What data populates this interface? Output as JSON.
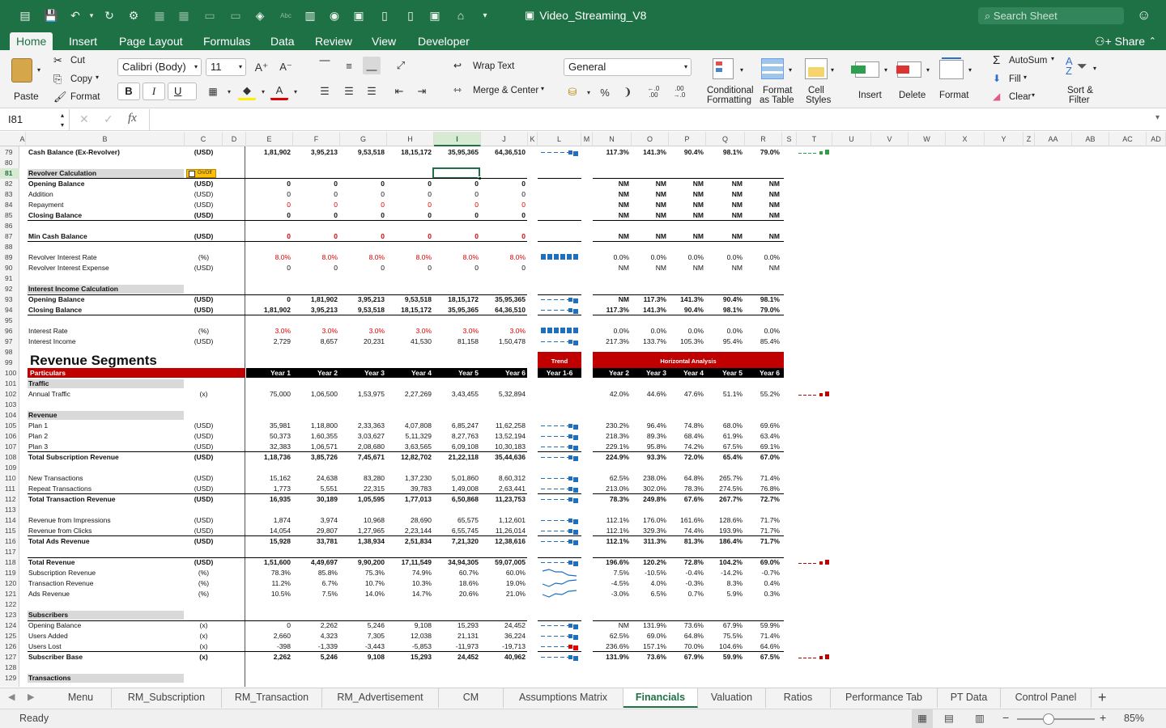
{
  "window": {
    "title": "Video_Streaming_V8",
    "search_placeholder": "Search Sheet"
  },
  "ribbon_tabs": [
    "Home",
    "Insert",
    "Page Layout",
    "Formulas",
    "Data",
    "Review",
    "View",
    "Developer"
  ],
  "share_label": "Share",
  "ribbon": {
    "paste": "Paste",
    "cut": "Cut",
    "copy": "Copy",
    "format": "Format",
    "font_name": "Calibri (Body)",
    "font_size": "11",
    "wrap_text": "Wrap Text",
    "merge_center": "Merge & Center",
    "number_format": "General",
    "conditional_formatting": [
      "Conditional",
      "Formatting"
    ],
    "format_as_table": [
      "Format",
      "as Table"
    ],
    "cell_styles": [
      "Cell",
      "Styles"
    ],
    "insert": "Insert",
    "delete": "Delete",
    "format_cells": "Format",
    "autosum": "AutoSum",
    "fill": "Fill",
    "clear": "Clear",
    "sort_filter": [
      "Sort &",
      "Filter"
    ],
    "bold": "B",
    "italic": "I",
    "underline": "U"
  },
  "formula_bar": {
    "name_box": "I81",
    "fx": "fx",
    "value": ""
  },
  "columns": [
    "A",
    "B",
    "C",
    "D",
    "E",
    "F",
    "G",
    "H",
    "I",
    "J",
    "K",
    "L",
    "M",
    "N",
    "O",
    "P",
    "Q",
    "R",
    "S",
    "T",
    "U",
    "V",
    "W",
    "X",
    "Y",
    "Z",
    "AA",
    "AB",
    "AC",
    "AD"
  ],
  "rows": [
    {
      "n": "79",
      "label": "Cash Balance (Ex-Revolver)",
      "bold": true,
      "unit": "(USD)",
      "vals": [
        "1,81,902",
        "3,95,213",
        "9,53,518",
        "18,15,172",
        "35,95,365",
        "64,36,510"
      ],
      "ha": [
        "117.3%",
        "141.3%",
        "90.4%",
        "98.1%",
        "79.0%"
      ],
      "spark": "bar-green",
      "tspark": "green"
    },
    {
      "n": "80"
    },
    {
      "n": "81",
      "label": "Revolver Calculation",
      "section": true,
      "toggle": "On/Off"
    },
    {
      "n": "82",
      "label": "Opening Balance",
      "bold": true,
      "unit": "(USD)",
      "vals": [
        "0",
        "0",
        "0",
        "0",
        "0",
        "0"
      ],
      "ha": [
        "NM",
        "NM",
        "NM",
        "NM",
        "NM"
      ],
      "hab": true
    },
    {
      "n": "83",
      "label": "Addition",
      "unit": "(USD)",
      "vals": [
        "0",
        "0",
        "0",
        "0",
        "0",
        "0"
      ],
      "ha": [
        "NM",
        "NM",
        "NM",
        "NM",
        "NM"
      ],
      "hab": true
    },
    {
      "n": "84",
      "label": "Repayment",
      "unit": "(USD)",
      "vals": [
        "0",
        "0",
        "0",
        "0",
        "0",
        "0"
      ],
      "red": true,
      "ha": [
        "NM",
        "NM",
        "NM",
        "NM",
        "NM"
      ],
      "hab": true
    },
    {
      "n": "85",
      "label": "Closing Balance",
      "bold": true,
      "unit": "(USD)",
      "vals": [
        "0",
        "0",
        "0",
        "0",
        "0",
        "0"
      ],
      "ha": [
        "NM",
        "NM",
        "NM",
        "NM",
        "NM"
      ],
      "hab": true,
      "line_below": true
    },
    {
      "n": "86"
    },
    {
      "n": "87",
      "label": "Min Cash Balance",
      "bold": true,
      "unit": "(USD)",
      "vals": [
        "0",
        "0",
        "0",
        "0",
        "0",
        "0"
      ],
      "red": true,
      "ha": [
        "NM",
        "NM",
        "NM",
        "NM",
        "NM"
      ],
      "line_below": true
    },
    {
      "n": "88"
    },
    {
      "n": "89",
      "label": "Revolver Interest Rate",
      "unit": "(%)",
      "vals": [
        "8.0%",
        "8.0%",
        "8.0%",
        "8.0%",
        "8.0%",
        "8.0%"
      ],
      "red": true,
      "ha": [
        "0.0%",
        "0.0%",
        "0.0%",
        "0.0%",
        "0.0%"
      ],
      "spark": "flat"
    },
    {
      "n": "90",
      "label": "Revolver Interest Expense",
      "unit": "(USD)",
      "vals": [
        "0",
        "0",
        "0",
        "0",
        "0",
        "0"
      ],
      "ha": [
        "NM",
        "NM",
        "NM",
        "NM",
        "NM"
      ]
    },
    {
      "n": "91"
    },
    {
      "n": "92",
      "label": "Interest Income Calculation",
      "section": true
    },
    {
      "n": "93",
      "label": "Opening Balance",
      "bold": true,
      "unit": "(USD)",
      "vals": [
        "0",
        "1,81,902",
        "3,95,213",
        "9,53,518",
        "18,15,172",
        "35,95,365"
      ],
      "ha": [
        "NM",
        "117.3%",
        "141.3%",
        "90.4%",
        "98.1%"
      ],
      "spark": "bar",
      "line_above": true
    },
    {
      "n": "94",
      "label": "Closing Balance",
      "bold": true,
      "unit": "(USD)",
      "vals": [
        "1,81,902",
        "3,95,213",
        "9,53,518",
        "18,15,172",
        "35,95,365",
        "64,36,510"
      ],
      "ha": [
        "117.3%",
        "141.3%",
        "90.4%",
        "98.1%",
        "79.0%"
      ],
      "spark": "bar",
      "line_below": true
    },
    {
      "n": "95"
    },
    {
      "n": "96",
      "label": "Interest Rate",
      "unit": "(%)",
      "vals": [
        "3.0%",
        "3.0%",
        "3.0%",
        "3.0%",
        "3.0%",
        "3.0%"
      ],
      "red": true,
      "ha": [
        "0.0%",
        "0.0%",
        "0.0%",
        "0.0%",
        "0.0%"
      ],
      "spark": "flat"
    },
    {
      "n": "97",
      "label": "Interest Income",
      "unit": "(USD)",
      "vals": [
        "2,729",
        "8,657",
        "20,231",
        "41,530",
        "81,158",
        "1,50,478"
      ],
      "ha": [
        "217.3%",
        "133.7%",
        "105.3%",
        "95.4%",
        "85.4%"
      ],
      "spark": "bar"
    },
    {
      "n": "98"
    },
    {
      "n": "99",
      "title": "Revenue Segments",
      "trend": "Trend",
      "horizontal": "Horizontal Analysis"
    },
    {
      "n": "100",
      "header": true,
      "label": "Particulars",
      "years": [
        "Year 1",
        "Year 2",
        "Year 3",
        "Year 4",
        "Year 5",
        "Year 6"
      ],
      "trend_range": "Year 1-6",
      "ha_years": [
        "Year 2",
        "Year 3",
        "Year 4",
        "Year 5",
        "Year 6"
      ]
    },
    {
      "n": "101",
      "label": "Traffic",
      "section": true
    },
    {
      "n": "102",
      "label": "Annual Traffic",
      "unit": "(x)",
      "vals": [
        "75,000",
        "1,06,500",
        "1,53,975",
        "2,27,269",
        "3,43,455",
        "5,32,894"
      ],
      "ha": [
        "42.0%",
        "44.6%",
        "47.6%",
        "51.1%",
        "55.2%"
      ],
      "tspark": "red"
    },
    {
      "n": "103"
    },
    {
      "n": "104",
      "label": "Revenue",
      "section": true
    },
    {
      "n": "105",
      "label": "Plan 1",
      "unit": "(USD)",
      "vals": [
        "35,981",
        "1,18,800",
        "2,33,363",
        "4,07,808",
        "6,85,247",
        "11,62,258"
      ],
      "ha": [
        "230.2%",
        "96.4%",
        "74.8%",
        "68.0%",
        "69.6%"
      ],
      "spark": "bar"
    },
    {
      "n": "106",
      "label": "Plan 2",
      "unit": "(USD)",
      "vals": [
        "50,373",
        "1,60,355",
        "3,03,627",
        "5,11,329",
        "8,27,763",
        "13,52,194"
      ],
      "ha": [
        "218.3%",
        "89.3%",
        "68.4%",
        "61.9%",
        "63.4%"
      ],
      "spark": "bar"
    },
    {
      "n": "107",
      "label": "Plan 3",
      "unit": "(USD)",
      "vals": [
        "32,383",
        "1,06,571",
        "2,08,680",
        "3,63,565",
        "6,09,108",
        "10,30,183"
      ],
      "ha": [
        "229.1%",
        "95.8%",
        "74.2%",
        "67.5%",
        "69.1%"
      ],
      "spark": "bar",
      "line_below": true
    },
    {
      "n": "108",
      "label": "Total Subscription Revenue",
      "bold": true,
      "unit": "(USD)",
      "vals": [
        "1,18,736",
        "3,85,726",
        "7,45,671",
        "12,82,702",
        "21,22,118",
        "35,44,636"
      ],
      "ha": [
        "224.9%",
        "93.3%",
        "72.0%",
        "65.4%",
        "67.0%"
      ],
      "spark": "bar"
    },
    {
      "n": "109"
    },
    {
      "n": "110",
      "label": "New Transactions",
      "unit": "(USD)",
      "vals": [
        "15,162",
        "24,638",
        "83,280",
        "1,37,230",
        "5,01,860",
        "8,60,312"
      ],
      "ha": [
        "62.5%",
        "238.0%",
        "64.8%",
        "265.7%",
        "71.4%"
      ],
      "spark": "bar"
    },
    {
      "n": "111",
      "label": "Repeat Transactions",
      "unit": "(USD)",
      "vals": [
        "1,773",
        "5,551",
        "22,315",
        "39,783",
        "1,49,008",
        "2,63,441"
      ],
      "ha": [
        "213.0%",
        "302.0%",
        "78.3%",
        "274.5%",
        "76.8%"
      ],
      "spark": "bar",
      "line_below": true
    },
    {
      "n": "112",
      "label": "Total Transaction Revenue",
      "bold": true,
      "unit": "(USD)",
      "vals": [
        "16,935",
        "30,189",
        "1,05,595",
        "1,77,013",
        "6,50,868",
        "11,23,753"
      ],
      "ha": [
        "78.3%",
        "249.8%",
        "67.6%",
        "267.7%",
        "72.7%"
      ],
      "spark": "bar"
    },
    {
      "n": "113"
    },
    {
      "n": "114",
      "label": "Revenue from Impressions",
      "unit": "(USD)",
      "vals": [
        "1,874",
        "3,974",
        "10,968",
        "28,690",
        "65,575",
        "1,12,601"
      ],
      "ha": [
        "112.1%",
        "176.0%",
        "161.6%",
        "128.6%",
        "71.7%"
      ],
      "spark": "bar"
    },
    {
      "n": "115",
      "label": "Revenue from Clicks",
      "unit": "(USD)",
      "vals": [
        "14,054",
        "29,807",
        "1,27,965",
        "2,23,144",
        "6,55,745",
        "11,26,014"
      ],
      "ha": [
        "112.1%",
        "329.3%",
        "74.4%",
        "193.9%",
        "71.7%"
      ],
      "spark": "bar",
      "line_below": true
    },
    {
      "n": "116",
      "label": "Total Ads Revenue",
      "bold": true,
      "unit": "(USD)",
      "vals": [
        "15,928",
        "33,781",
        "1,38,934",
        "2,51,834",
        "7,21,320",
        "12,38,616"
      ],
      "ha": [
        "112.1%",
        "311.3%",
        "81.3%",
        "186.4%",
        "71.7%"
      ],
      "spark": "bar"
    },
    {
      "n": "117"
    },
    {
      "n": "118",
      "label": "Total Revenue",
      "bold": true,
      "unit": "(USD)",
      "vals": [
        "1,51,600",
        "4,49,697",
        "9,90,200",
        "17,11,549",
        "34,94,305",
        "59,07,005"
      ],
      "ha": [
        "196.6%",
        "120.2%",
        "72.8%",
        "104.2%",
        "69.0%"
      ],
      "spark": "bar",
      "tspark": "red",
      "line_above": true
    },
    {
      "n": "119",
      "label": "Subscription Revenue",
      "unit": "(%)",
      "vals": [
        "78.3%",
        "85.8%",
        "75.3%",
        "74.9%",
        "60.7%",
        "60.0%"
      ],
      "ha": [
        "7.5%",
        "-10.5%",
        "-0.4%",
        "-14.2%",
        "-0.7%"
      ],
      "spark": "line-down"
    },
    {
      "n": "120",
      "label": "Transaction Revenue",
      "unit": "(%)",
      "vals": [
        "11.2%",
        "6.7%",
        "10.7%",
        "10.3%",
        "18.6%",
        "19.0%"
      ],
      "ha": [
        "-4.5%",
        "4.0%",
        "-0.3%",
        "8.3%",
        "0.4%"
      ],
      "spark": "line-up"
    },
    {
      "n": "121",
      "label": "Ads Revenue",
      "unit": "(%)",
      "vals": [
        "10.5%",
        "7.5%",
        "14.0%",
        "14.7%",
        "20.6%",
        "21.0%"
      ],
      "ha": [
        "-3.0%",
        "6.5%",
        "0.7%",
        "5.9%",
        "0.3%"
      ],
      "spark": "line-up"
    },
    {
      "n": "122"
    },
    {
      "n": "123",
      "label": "Subscribers",
      "section": true
    },
    {
      "n": "124",
      "label": "Opening Balance",
      "unit": "(x)",
      "vals": [
        "0",
        "2,262",
        "5,246",
        "9,108",
        "15,293",
        "24,452"
      ],
      "ha": [
        "NM",
        "131.9%",
        "73.6%",
        "67.9%",
        "59.9%"
      ],
      "spark": "bar",
      "line_above": true
    },
    {
      "n": "125",
      "label": "Users Added",
      "unit": "(x)",
      "vals": [
        "2,660",
        "4,323",
        "7,305",
        "12,038",
        "21,131",
        "36,224"
      ],
      "ha": [
        "62.5%",
        "69.0%",
        "64.8%",
        "75.5%",
        "71.4%"
      ],
      "spark": "bar"
    },
    {
      "n": "126",
      "label": "Users Lost",
      "unit": "(x)",
      "vals": [
        "-398",
        "-1,339",
        "-3,443",
        "-5,853",
        "-11,973",
        "-19,713"
      ],
      "ha": [
        "236.6%",
        "157.1%",
        "70.0%",
        "104.6%",
        "64.6%"
      ],
      "spark": "bar-red",
      "line_below": true
    },
    {
      "n": "127",
      "label": "Subscriber Base",
      "bold": true,
      "unit": "(x)",
      "vals": [
        "2,262",
        "5,246",
        "9,108",
        "15,293",
        "24,452",
        "40,962"
      ],
      "ha": [
        "131.9%",
        "73.6%",
        "67.9%",
        "59.9%",
        "67.5%"
      ],
      "spark": "bar",
      "tspark": "red"
    },
    {
      "n": "128"
    }
  ],
  "partial_row": {
    "n": "129",
    "label": "Transactions"
  },
  "sheet_tabs": [
    "Menu",
    "RM_Subscription",
    "RM_Transaction",
    "RM_Advertisement",
    "CM",
    "Assumptions Matrix",
    "Financials",
    "Valuation",
    "Ratios",
    "Performance Tab",
    "PT Data",
    "Control Panel"
  ],
  "active_sheet": "Financials",
  "status": {
    "ready": "Ready",
    "zoom": "85%"
  },
  "colors": {
    "excel_green": "#1e7145",
    "header_red": "#c00000",
    "negative_red": "#e00000",
    "spark_blue": "#1f6fbf"
  }
}
